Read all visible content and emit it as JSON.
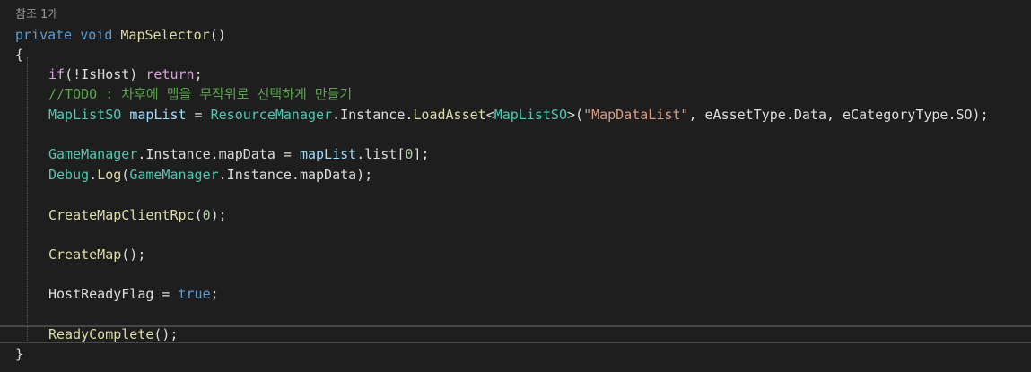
{
  "codelens": "참조 1개",
  "code": {
    "l1": {
      "kw": "private",
      "kw2": "void",
      "method": "MapSelector",
      "rest": "()"
    },
    "l2": {
      "text": "{"
    },
    "l3": {
      "ctl1": "if",
      "p1": "(!IsHost) ",
      "ctl2": "return",
      "p2": ";"
    },
    "l4": {
      "comment": "//TODO : 차후에 맵을 무작위로 선택하게 만들기"
    },
    "l5": {
      "type1": "MapListSO",
      "var": "mapList",
      "eq": " = ",
      "type2": "ResourceManager",
      "p1": ".Instance.",
      "method": "LoadAsset",
      "lt": "<",
      "type3": "MapListSO",
      "p2": ">(",
      "str": "\"MapDataList\"",
      "p3": ", eAssetType.Data, eCategoryType.SO);"
    },
    "l6": {
      "type": "GameManager",
      "p1": ".Instance.mapData = ",
      "var": "mapList",
      "p2": ".list[",
      "num": "0",
      "p3": "];"
    },
    "l7": {
      "type1": "Debug",
      "p1": ".",
      "method": "Log",
      "p2": "(",
      "type2": "GameManager",
      "p3": ".Instance.mapData);"
    },
    "l8": {
      "method": "CreateMapClientRpc",
      "p1": "(",
      "num": "0",
      "p2": ");"
    },
    "l9": {
      "method": "CreateMap",
      "p1": "();"
    },
    "l10": {
      "p1": "HostReadyFlag = ",
      "kw": "true",
      "p2": ";"
    },
    "l11": {
      "method": "ReadyComplete",
      "p1": "();"
    },
    "l12": {
      "text": "}"
    }
  }
}
